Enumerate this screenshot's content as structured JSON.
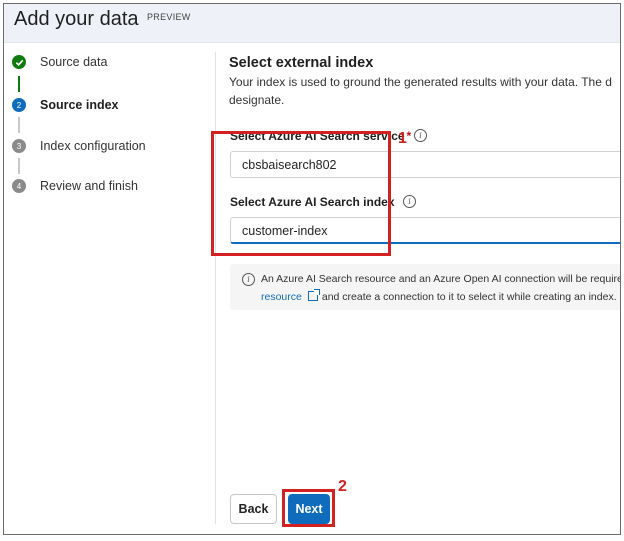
{
  "header": {
    "title": "Add your data",
    "badge": "PREVIEW"
  },
  "steps": [
    {
      "label": "Source data",
      "state": "done",
      "icon": "checkmark-icon"
    },
    {
      "label": "Source index",
      "state": "current",
      "number": "2"
    },
    {
      "label": "Index configuration",
      "state": "pending",
      "number": "3"
    },
    {
      "label": "Review and finish",
      "state": "pending",
      "number": "4"
    }
  ],
  "main": {
    "section_title": "Select external index",
    "description_line1": "Your index is used to ground the generated results with your data. The d",
    "description_line2": "designate.",
    "service_field": {
      "label": "Select Azure AI Search service",
      "required_mark": "*",
      "value": "cbsbaisearch802"
    },
    "index_field": {
      "label": "Select Azure AI Search index",
      "value": "customer-index"
    },
    "notice": {
      "line1": "An Azure AI Search resource and an Azure Open AI connection will be required",
      "link_text": "resource",
      "line2_rest": "and create a connection to it to select it while creating an index."
    }
  },
  "buttons": {
    "back": "Back",
    "next": "Next"
  },
  "annotations": {
    "box1_number": "1",
    "box2_number": "2",
    "color": "#d32020"
  },
  "colors": {
    "accent": "#0f6cbd",
    "done": "#107c10"
  }
}
